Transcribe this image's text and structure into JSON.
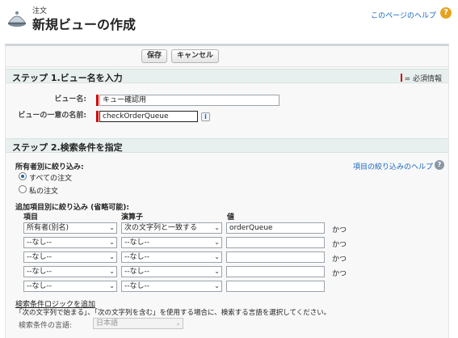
{
  "header": {
    "object_label": "注文",
    "title": "新規ビューの作成",
    "help_link": "このページのヘルプ",
    "icon_name": "orders-icon"
  },
  "toolbar": {
    "save_label": "保存",
    "cancel_label": "キャンセル"
  },
  "step1": {
    "title": "ステップ 1.ビュー名を入力",
    "required_legend": "= 必須情報",
    "view_name_label": "ビュー名:",
    "view_name_value": "キュー確認用",
    "unique_name_label": "ビューの一意の名前:",
    "unique_name_value": "checkOrderQueue"
  },
  "step2": {
    "title": "ステップ 2.検索条件を指定",
    "owner_filter_label": "所有者別に絞り込み:",
    "owner_options": [
      {
        "label": "すべての注文",
        "selected": true
      },
      {
        "label": "私の注文",
        "selected": false
      }
    ],
    "filter_help_link": "項目の絞り込みのヘルプ",
    "additional_filter_label": "追加項目別に絞り込み (省略可能):",
    "columns": {
      "field": "項目",
      "operator": "演算子",
      "value": "値"
    },
    "filters": [
      {
        "field": "所有者(別名)",
        "operator": "次の文字列と一致する",
        "value": "orderQueue",
        "connector": "かつ"
      },
      {
        "field": "--なし--",
        "operator": "--なし--",
        "value": "",
        "connector": "かつ"
      },
      {
        "field": "--なし--",
        "operator": "--なし--",
        "value": "",
        "connector": "かつ"
      },
      {
        "field": "--なし--",
        "operator": "--なし--",
        "value": "",
        "connector": "かつ"
      },
      {
        "field": "--なし--",
        "operator": "--なし--",
        "value": "",
        "connector": ""
      }
    ],
    "add_logic_link": "検索条件ロジックを追加",
    "language_note": "「次の文字列で始まる」、「次の文字列を含む」を使用する場合に、検索する言語を選択してください。",
    "language_label": "検索条件の言語:",
    "language_value": "日本語"
  }
}
